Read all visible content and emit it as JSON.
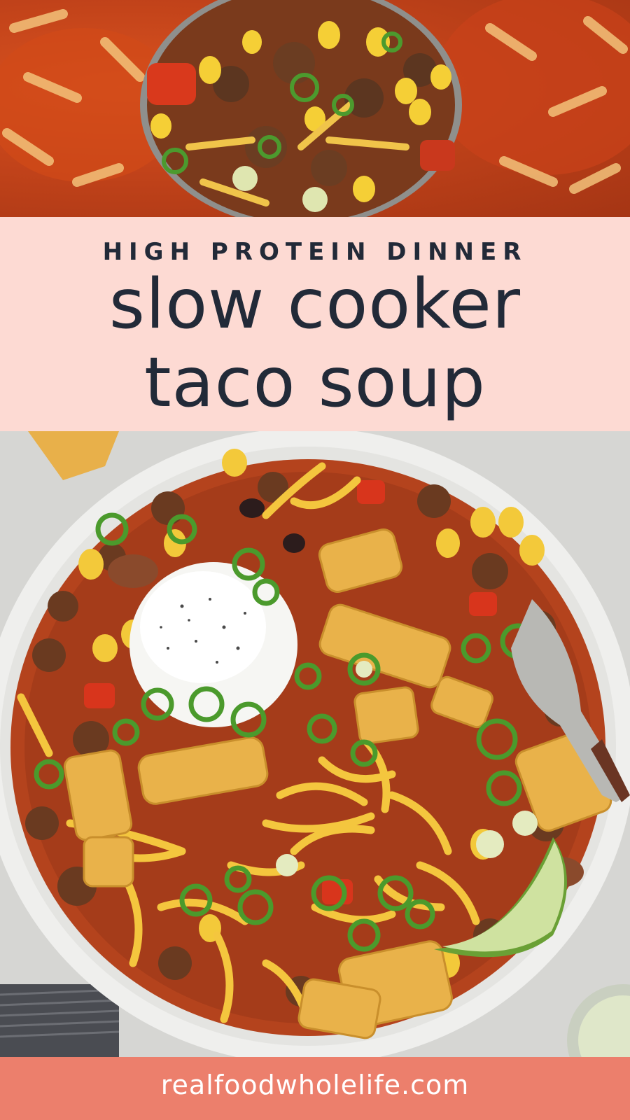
{
  "pin": {
    "kicker": "HIGH PROTEIN DINNER",
    "headline_line1": "slow cooker",
    "headline_line2": "taco soup",
    "website": "realfoodwholelife.com"
  },
  "photos": {
    "top": "ladle of taco soup with corn, ground beef, green onions and shredded cheese",
    "bottom": "bowl of slow cooker taco soup topped with sour cream, shredded cheddar, corn chips, green onions and a lime wedge"
  },
  "colors": {
    "title_band": "#fddad3",
    "title_text": "#222a38",
    "footer_band": "#ec7f6c",
    "footer_text": "#ffffff"
  }
}
